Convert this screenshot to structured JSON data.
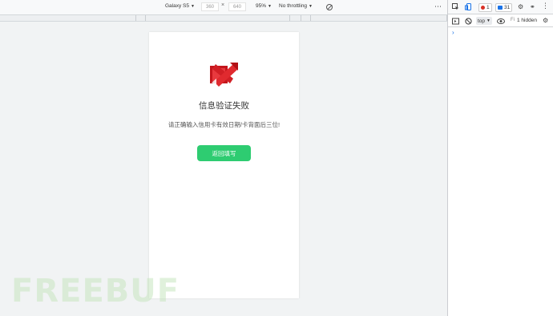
{
  "device_toolbar": {
    "device": "Galaxy S5",
    "width": "360",
    "height": "640",
    "times": "×",
    "zoom": "95%",
    "throttle": "No throttling",
    "more": "⋯"
  },
  "page": {
    "error_title": "信息验证失败",
    "error_message": "请正确输入信用卡有效日期/卡背面后三位!",
    "back_button": "返回填写",
    "button_color": "#2ecc71"
  },
  "devtools": {
    "errors_count": "1",
    "messages_count": "31",
    "context": "top",
    "filter_placeholder": "Fi",
    "hidden_label": "1 hidden",
    "prompt": "›"
  },
  "watermark": "FREEBUF"
}
